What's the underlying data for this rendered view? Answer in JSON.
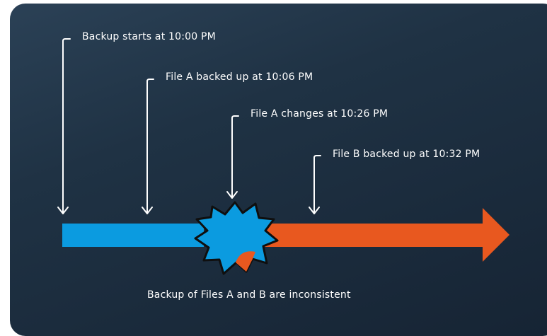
{
  "diagram": {
    "events": [
      {
        "id": "backup-start",
        "text": "Backup starts at 10:00 PM"
      },
      {
        "id": "file-a-backed",
        "text": "File A backed up at 10:06 PM"
      },
      {
        "id": "file-a-changes",
        "text": "File A changes at 10:26 PM"
      },
      {
        "id": "file-b-backed",
        "text": "File B backed up at 10:32 PM"
      }
    ],
    "footer": "Backup of Files A and B are inconsistent",
    "colors": {
      "background_top": "#2b4156",
      "background_bottom": "#162434",
      "timeline_before": "#0b9be0",
      "timeline_after": "#e8581f",
      "arrow_lines": "#ffffff",
      "burst_outline": "#0f0f0f"
    }
  }
}
